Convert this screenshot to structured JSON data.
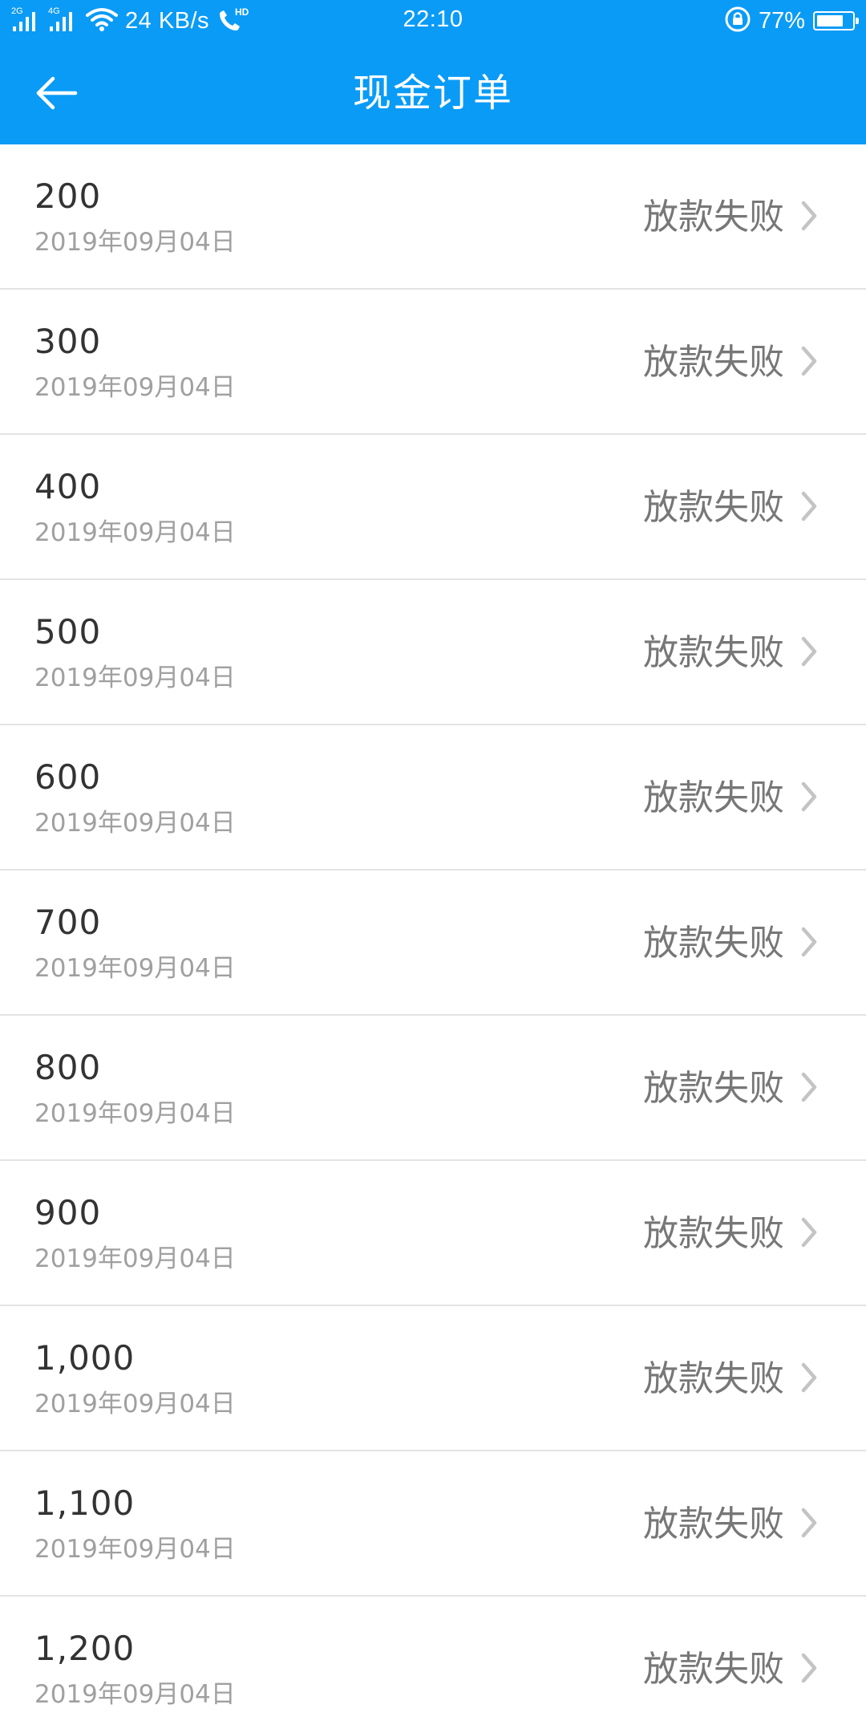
{
  "status_bar": {
    "network_2g": "2G",
    "network_4g": "4G",
    "speed": "24 KB/s",
    "call_badge": "HD",
    "time": "22:10",
    "battery_percent": "77%",
    "battery_level": 0.77
  },
  "header": {
    "title": "现金订单",
    "back_icon": "arrow-left-icon"
  },
  "colors": {
    "primary": "#0a9bf6",
    "amount_text": "#333333",
    "date_text": "#a0a0a0",
    "status_text": "#777777",
    "divider": "#e3e3e3"
  },
  "orders": [
    {
      "amount": "200",
      "date": "2019年09月04日",
      "status": "放款失败"
    },
    {
      "amount": "300",
      "date": "2019年09月04日",
      "status": "放款失败"
    },
    {
      "amount": "400",
      "date": "2019年09月04日",
      "status": "放款失败"
    },
    {
      "amount": "500",
      "date": "2019年09月04日",
      "status": "放款失败"
    },
    {
      "amount": "600",
      "date": "2019年09月04日",
      "status": "放款失败"
    },
    {
      "amount": "700",
      "date": "2019年09月04日",
      "status": "放款失败"
    },
    {
      "amount": "800",
      "date": "2019年09月04日",
      "status": "放款失败"
    },
    {
      "amount": "900",
      "date": "2019年09月04日",
      "status": "放款失败"
    },
    {
      "amount": "1,000",
      "date": "2019年09月04日",
      "status": "放款失败"
    },
    {
      "amount": "1,100",
      "date": "2019年09月04日",
      "status": "放款失败"
    },
    {
      "amount": "1,200",
      "date": "2019年09月04日",
      "status": "放款失败"
    }
  ]
}
